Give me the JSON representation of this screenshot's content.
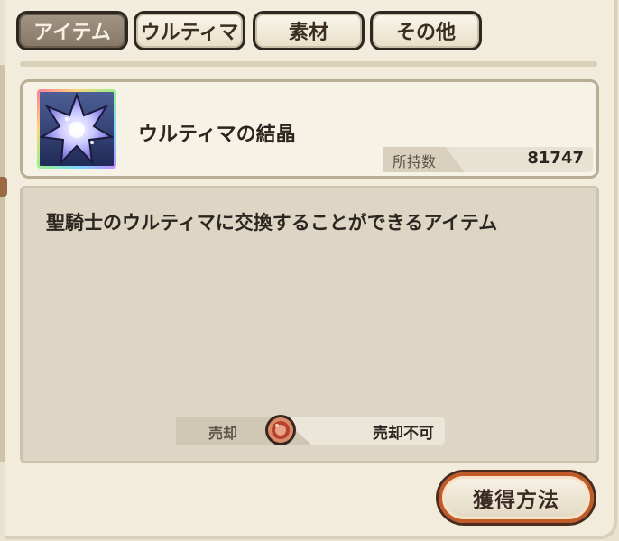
{
  "tabs": [
    {
      "label": "アイテム",
      "active": true
    },
    {
      "label": "ウルティマ",
      "active": false
    },
    {
      "label": "素材",
      "active": false
    },
    {
      "label": "その他",
      "active": false
    }
  ],
  "item": {
    "name": "ウルティマの結晶",
    "icon": "crystal-icon",
    "owned_label": "所持数",
    "owned_value": "81747"
  },
  "description": {
    "text": "聖騎士のウルティマに交換することができるアイテム"
  },
  "sell": {
    "label": "売却",
    "icon": "coin-icon",
    "value": "売却不可"
  },
  "acquire_button": {
    "label": "獲得方法"
  },
  "colors": {
    "accent": "#c05a27",
    "active_tab": "#857766",
    "panel": "#ddd6c4"
  }
}
